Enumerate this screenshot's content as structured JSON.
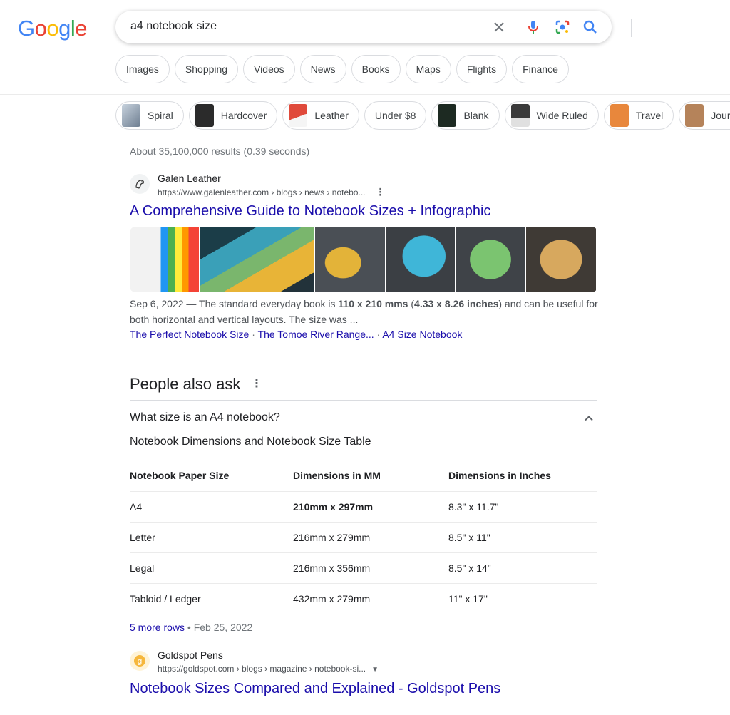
{
  "logo": {
    "letters": [
      {
        "ch": "G",
        "color": "#4285F4"
      },
      {
        "ch": "o",
        "color": "#EA4335"
      },
      {
        "ch": "o",
        "color": "#FBBC05"
      },
      {
        "ch": "g",
        "color": "#4285F4"
      },
      {
        "ch": "l",
        "color": "#34A853"
      },
      {
        "ch": "e",
        "color": "#EA4335"
      }
    ]
  },
  "search": {
    "query": "a4 notebook size",
    "icons": [
      "clear-icon",
      "microphone-icon",
      "lens-icon",
      "search-icon"
    ]
  },
  "tabs": [
    "Images",
    "Shopping",
    "Videos",
    "News",
    "Books",
    "Maps",
    "Flights",
    "Finance"
  ],
  "chips": [
    {
      "label": "Spiral",
      "color": "#8a9bb0"
    },
    {
      "label": "Hardcover",
      "color": "#2b2b2b"
    },
    {
      "label": "Leather",
      "color": "#c0392b"
    },
    {
      "label": "Under $8"
    },
    {
      "label": "Blank",
      "color": "#1d2a22"
    },
    {
      "label": "Wide Ruled",
      "color": "#3a3a3a"
    },
    {
      "label": "Travel",
      "color": "#e8873c"
    },
    {
      "label": "Journal",
      "color": "#b5835a"
    }
  ],
  "stats": "About 35,100,000 results (0.39 seconds)",
  "result1": {
    "site_name": "Galen Leather",
    "url": "https://www.galenleather.com › blogs › news › notebo...",
    "title": "A Comprehensive Guide to Notebook Sizes + Infographic",
    "images": [
      "#e8eaf0",
      "#2b8ca0",
      "#4a4f55",
      "#2f7fa6",
      "#4c7d52",
      "#6b5a42"
    ],
    "snippet_date": "Sep 6, 2022",
    "snippet_a": "The standard everyday book is",
    "snippet_bold1": "110 x 210 mms",
    "snippet_open": "(",
    "snippet_bold2": "4.33 x 8.26 inches",
    "snippet_b": ") and can be useful for both horizontal and vertical layouts. The size was ...",
    "sitelinks": [
      "The Perfect Notebook Size",
      "The Tomoe River Range...",
      "A4 Size Notebook"
    ]
  },
  "paa": {
    "title": "People also ask",
    "question": "What size is an A4 notebook?",
    "caption": "Notebook Dimensions and Notebook Size Table",
    "headers": [
      "Notebook Paper Size",
      "Dimensions in MM",
      "Dimensions in Inches"
    ],
    "rows": [
      [
        "A4",
        "210mm x 297mm",
        "8.3\" x 11.7\""
      ],
      [
        "Letter",
        "216mm x 279mm",
        "8.5\" x 11\""
      ],
      [
        "Legal",
        "216mm x 356mm",
        "8.5\" x 14\""
      ],
      [
        "Tabloid / Ledger",
        "432mm x 279mm",
        "11\" x 17\""
      ]
    ],
    "more_rows": "5 more rows",
    "date": "Feb 25, 2022"
  },
  "result2": {
    "site_name": "Goldspot Pens",
    "url": "https://goldspot.com › blogs › magazine › notebook-si...",
    "title": "Notebook Sizes Compared and Explained - Goldspot Pens"
  }
}
